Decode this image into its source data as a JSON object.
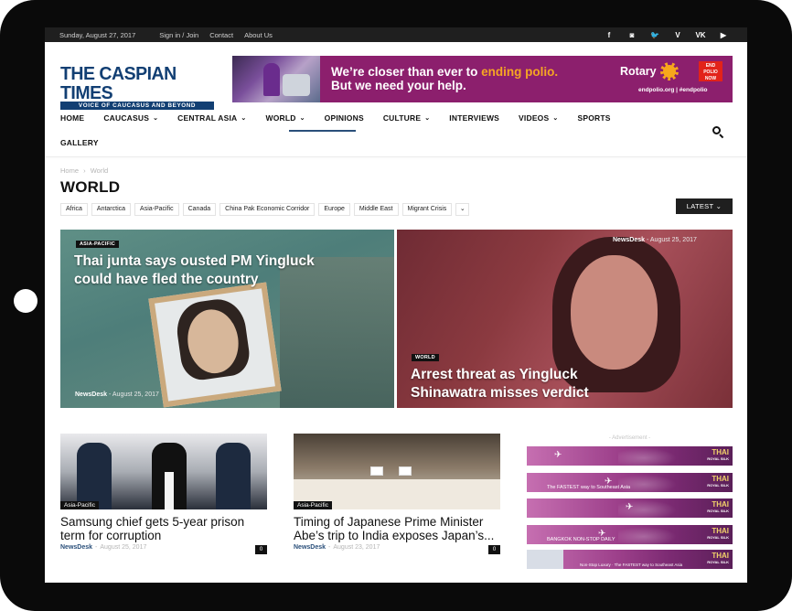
{
  "topbar": {
    "date": "Sunday, August 27, 2017",
    "links": [
      "Sign in / Join",
      "Contact",
      "About Us"
    ],
    "social_icons": [
      {
        "name": "facebook-icon",
        "glyph": "f"
      },
      {
        "name": "instagram-icon",
        "glyph": "◙"
      },
      {
        "name": "twitter-icon",
        "glyph": "🐦"
      },
      {
        "name": "vimeo-icon",
        "glyph": "V"
      },
      {
        "name": "vk-icon",
        "glyph": "VK"
      },
      {
        "name": "youtube-icon",
        "glyph": "▶"
      }
    ]
  },
  "logo": {
    "title": "THE CASPIAN TIMES",
    "subtitle": "VOICE OF CAUCASUS AND BEYOND",
    "color": "#123f73"
  },
  "ad_banner": {
    "line1_prefix": "We’re closer than ever to ",
    "line1_highlight": "ending polio.",
    "line2": "But we need your help.",
    "brand": "Rotary",
    "badge": "END POLIO NOW",
    "url": "endpolio.org | #endpolio"
  },
  "nav": {
    "items": [
      {
        "label": "HOME",
        "dropdown": false
      },
      {
        "label": "CAUCASUS",
        "dropdown": true
      },
      {
        "label": "CENTRAL ASIA",
        "dropdown": true
      },
      {
        "label": "WORLD",
        "dropdown": true,
        "active": true
      },
      {
        "label": "OPINIONS",
        "dropdown": false
      },
      {
        "label": "CULTURE",
        "dropdown": true
      },
      {
        "label": "INTERVIEWS",
        "dropdown": false
      },
      {
        "label": "VIDEOS",
        "dropdown": true
      },
      {
        "label": "SPORTS",
        "dropdown": false
      }
    ],
    "second_row": "GALLERY",
    "chevron": "⌄",
    "accent": "#2a4f7a"
  },
  "breadcrumb": {
    "home": "Home",
    "sep": "›",
    "current": "World"
  },
  "page_title": "WORLD",
  "tags": [
    "Africa",
    "Antarctica",
    "Asia-Pacific",
    "Canada",
    "China Pak Economic Corridor",
    "Europe",
    "Middle East",
    "Migrant Crisis"
  ],
  "tags_more": "⌄",
  "sort_button": "LATEST ⌄",
  "featured": [
    {
      "category": "ASIA-PACIFIC",
      "title": "Thai junta says ousted PM Yingluck could have fled the country",
      "author": "NewsDesk",
      "date": "August 25, 2017"
    },
    {
      "category": "WORLD",
      "title": "Arrest threat as Yingluck Shinawatra misses verdict",
      "author": "NewsDesk",
      "date": "August 25, 2017"
    }
  ],
  "articles": [
    {
      "category": "Asia-Pacific",
      "title": "Samsung chief gets 5-year prison term for corruption",
      "author": "NewsDesk",
      "date": "August 25, 2017",
      "comments": "0"
    },
    {
      "category": "Asia-Pacific",
      "title": "Timing of Japanese Prime Minister Abe’s trip to India exposes Japan’s...",
      "author": "NewsDesk",
      "date": "August 23, 2017",
      "comments": "0"
    }
  ],
  "sidebar_ads": {
    "label": "- Advertisement -",
    "brand": "THAI",
    "brand_sub": "ROYAL SILK",
    "items": [
      {
        "text": ""
      },
      {
        "text": "The FASTEST way to Southeast Asia"
      },
      {
        "text": ""
      },
      {
        "text": "BANGKOK NON-STOP DAILY"
      },
      {
        "text": "Non-Stop Luxury · The FASTEST way to Southeast Asia"
      }
    ]
  },
  "dash": "-"
}
